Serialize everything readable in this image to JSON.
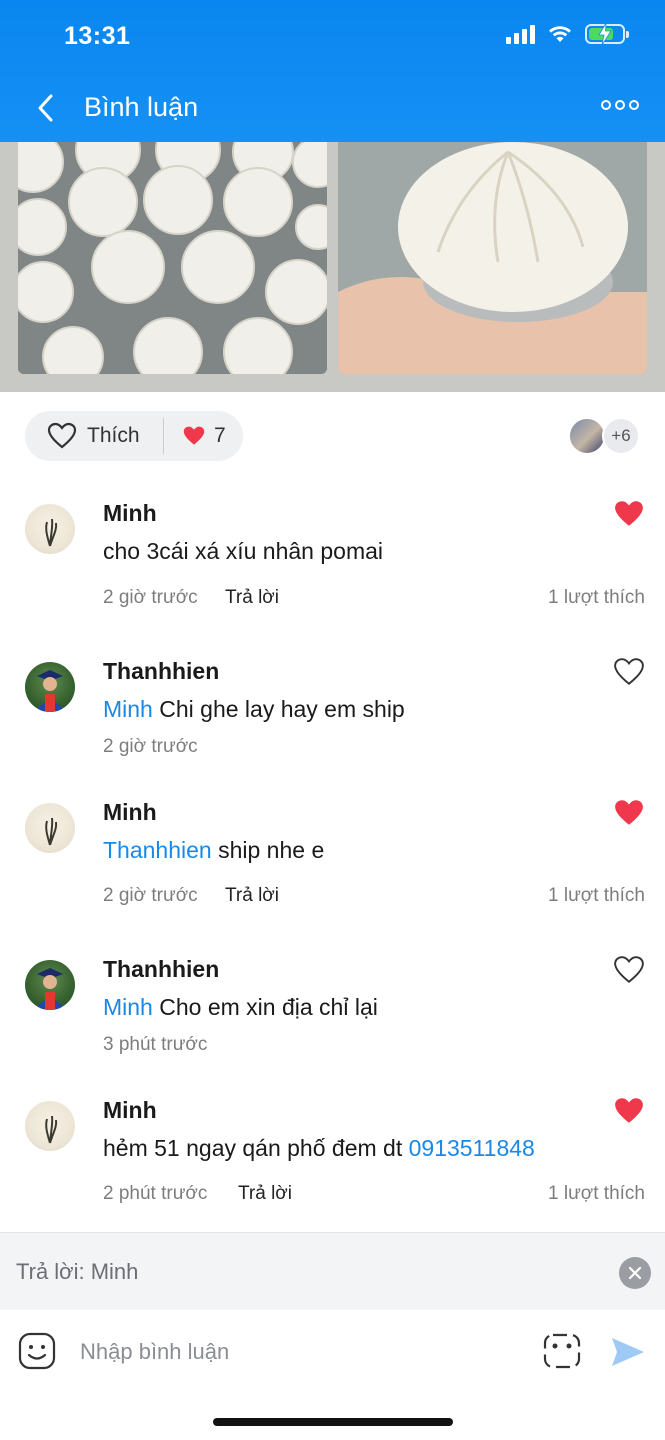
{
  "status_bar": {
    "time": "13:31"
  },
  "header": {
    "title": "Bình luận"
  },
  "like_bar": {
    "like_label": "Thích",
    "like_count": "7",
    "more_likers": "+6"
  },
  "comments": [
    {
      "author": "Minh",
      "mention": "",
      "text": "cho 3cái xá xíu nhân pomai",
      "time": "2 giờ trước",
      "reply": "Trả lời",
      "likes": "1 lượt thích",
      "liked": true
    },
    {
      "author": "Thanhhien",
      "mention": "Minh",
      "text": " Chi ghe lay hay em ship",
      "time": "2 giờ trước",
      "reply": "",
      "likes": "",
      "liked": false
    },
    {
      "author": "Minh",
      "mention": "Thanhhien",
      "text": " ship nhe e",
      "time": "2 giờ trước",
      "reply": "Trả lời",
      "likes": "1 lượt thích",
      "liked": true
    },
    {
      "author": "Thanhhien",
      "mention": "Minh",
      "text": " Cho em xin địa chỉ lại",
      "time": "3 phút trước",
      "reply": "",
      "likes": "",
      "liked": false
    },
    {
      "author": "Minh",
      "mention": "",
      "text": "hẻm 51 ngay qán phố đem dt ",
      "phone": "0913511848",
      "time": "2 phút trước",
      "reply": "Trả lời",
      "likes": "1 lượt thích",
      "liked": true
    }
  ],
  "reply_bar": {
    "label": "Trả lời: Minh"
  },
  "input": {
    "placeholder": "Nhập bình luận"
  },
  "colors": {
    "header": "#0a86f0",
    "mention": "#1a88e6",
    "heart": "#f0384c"
  }
}
